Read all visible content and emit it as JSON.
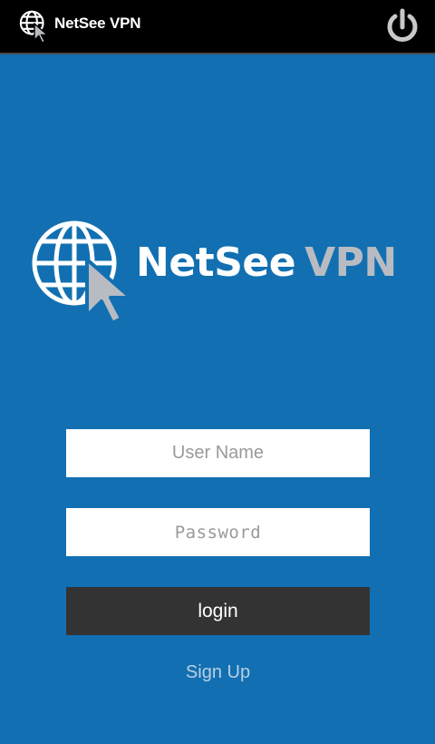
{
  "app_bar": {
    "title": "NetSee VPN",
    "icon": "globe-cursor-icon",
    "power_icon": "power-icon"
  },
  "logo": {
    "word_primary": "NetSee",
    "word_secondary": "VPN",
    "icon": "globe-cursor-icon"
  },
  "login_form": {
    "username_placeholder": "User Name",
    "password_placeholder": "Password",
    "login_label": "login",
    "signup_label": "Sign Up"
  },
  "colors": {
    "background": "#1270b2",
    "app_bar": "#000000",
    "button": "#333333",
    "logo_secondary": "#b8bcc2"
  }
}
